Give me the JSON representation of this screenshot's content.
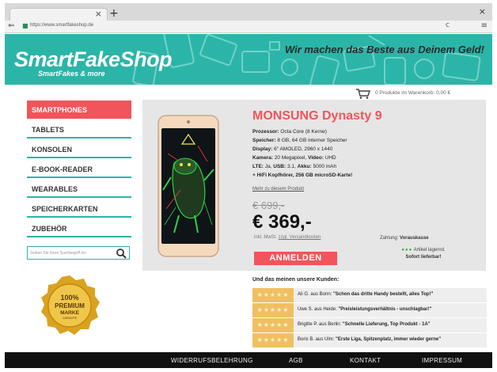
{
  "browser": {
    "tab_close": "×",
    "new_tab": "+",
    "window_close": "×",
    "url": "https://www.smartfakeshop.de",
    "reload": "c",
    "menu": "≡"
  },
  "header": {
    "brand": "SmartFakeShop",
    "tagline": "SmartFakes & more",
    "slogan": "Wir machen das Beste aus Deinem Geld!",
    "colors": {
      "banner": "#2bb5a8",
      "accent": "#f2545b"
    }
  },
  "cart": {
    "text": "0 Produkte im Warenkorb: 0,00 €"
  },
  "sidebar": {
    "items": [
      {
        "label": "SMARTPHONES",
        "active": true
      },
      {
        "label": "TABLETS"
      },
      {
        "label": "KONSOLEN"
      },
      {
        "label": "E-BOOK-READER"
      },
      {
        "label": "WEARABLES"
      },
      {
        "label": "SPEICHERKARTEN"
      },
      {
        "label": "ZUBEHÖR"
      }
    ],
    "search_placeholder": "Geben Sie Ihren Suchbegriff ein"
  },
  "badge": {
    "line1": "100%",
    "line2": "PREMIUM",
    "line3": "MARKE",
    "line4": "GARANTIE"
  },
  "product": {
    "title": "MONSUNG Dynasty 9",
    "specs": [
      {
        "k": "Prozessor:",
        "v": " Octa Core (8 Kerne)"
      },
      {
        "k": "Speicher:",
        "v": " 8 GB, 64 GB interner Speicher"
      },
      {
        "k": "Display:",
        "v": " 6\" AMOLED, 2960 x 1440"
      },
      {
        "k": "Kamera:",
        "v": " 20 Megapixel, ",
        "k2": "Video:",
        "v2": " UHD"
      },
      {
        "k": "LTE:",
        "v": " Ja, ",
        "k2": "USB:",
        "v2": " 3.1, ",
        "k3": "Akku:",
        "v3": " 5000 mAh"
      },
      {
        "k": "+ HiFi Kopfhörer, 256 GB microSD-Karte!",
        "v": ""
      }
    ],
    "more_link": "Mehr zu diesem Produkt",
    "old_price": "€ 699,-",
    "price": "€ 369,-",
    "vat_prefix": "inkl. MwSt. ",
    "vat_link": "zzgl. Versandkosten",
    "payment_label": "Zahlung: ",
    "payment_value": "Vorauskasse",
    "cta": "ANMELDEN",
    "stock_dots": "●●●",
    "stock_line1": " Artikel lagernd.",
    "stock_line2": "Sofort lieferbar!"
  },
  "reviews": {
    "title": "Und das meinen unsere Kunden:",
    "stars": "★★★★★",
    "items": [
      {
        "author": "Ali G. aus Bonn: ",
        "quote": "\"Schon das dritte Handy bestellt, alles Top!\""
      },
      {
        "author": "Uwe S. aus Heide: ",
        "quote": "\"Preisleistungsverhältnis - unschlagbar!\""
      },
      {
        "author": "Brigitte P. aus Berlin: ",
        "quote": "\"Schnelle Lieferung, Top Produkt - 1A\""
      },
      {
        "author": "Boris B. aus Ulm: ",
        "quote": "\"Erste Liga, Spitzenplatz, immer wieder gerne\""
      }
    ]
  },
  "footer": {
    "links": [
      "WIDERRUFSBELEHRUNG",
      "AGB",
      "KONTAKT",
      "IMPRESSUM"
    ]
  }
}
